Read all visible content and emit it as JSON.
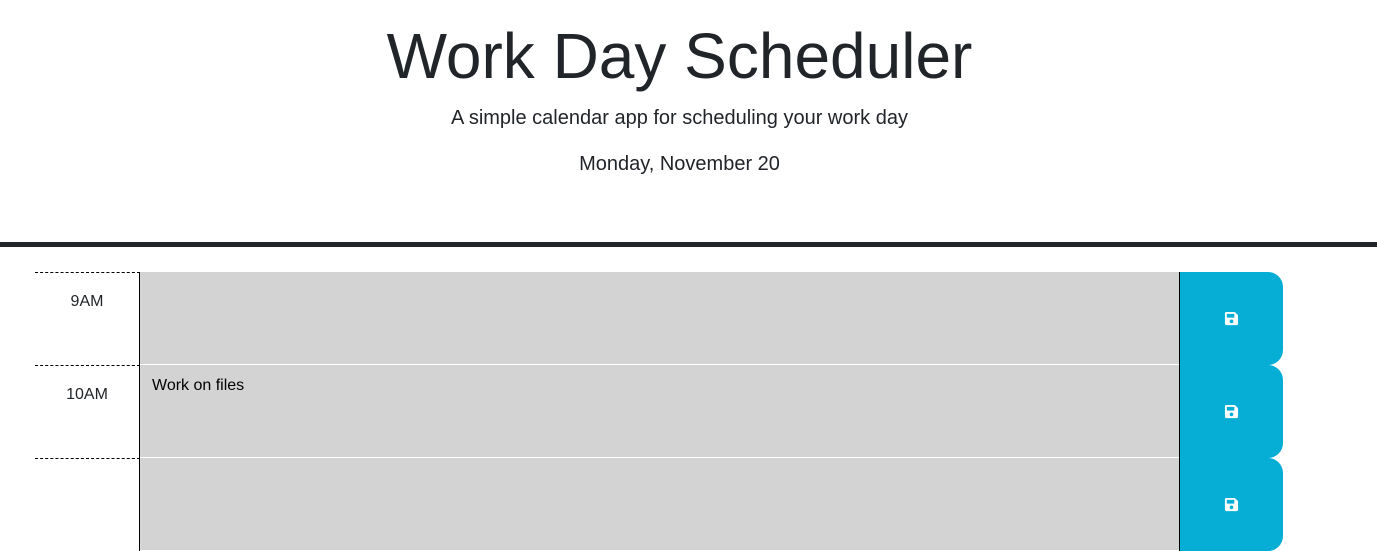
{
  "header": {
    "title": "Work Day Scheduler",
    "subtitle": "A simple calendar app for scheduling your work day",
    "current_day": "Monday, November 20"
  },
  "time_blocks": [
    {
      "hour": "9AM",
      "description": "",
      "save_icon": "floppy-disk-icon"
    },
    {
      "hour": "10AM",
      "description": "Work on files",
      "save_icon": "floppy-disk-icon"
    },
    {
      "hour": "",
      "description": "",
      "save_icon": "floppy-disk-icon"
    }
  ],
  "colors": {
    "save_button": "#06aed5",
    "past_block": "#d3d3d3",
    "header_border": "#212529"
  }
}
